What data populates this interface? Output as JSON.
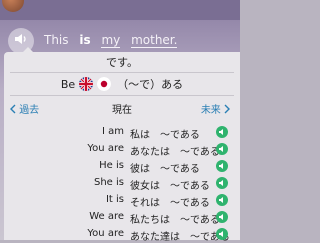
{
  "sentence": {
    "words": [
      "This",
      "is",
      "my",
      "mother."
    ]
  },
  "panel": {
    "word_header": "です。",
    "be_label": "Be",
    "be_meaning": "（〜で）ある",
    "nav": {
      "prev": "過去",
      "current": "現在",
      "next": "未来"
    },
    "rows": [
      {
        "en": "I am",
        "jp": "私は　〜である"
      },
      {
        "en": "You are",
        "jp": "あなたは　〜である"
      },
      {
        "en": "He is",
        "jp": "彼は　〜である"
      },
      {
        "en": "She is",
        "jp": "彼女は　〜である"
      },
      {
        "en": "It is",
        "jp": "それは　〜である"
      },
      {
        "en": "We are",
        "jp": "私たちは　〜である"
      },
      {
        "en": "You are",
        "jp": "あなた達は　〜である"
      }
    ]
  },
  "colors": {
    "accent_blue": "#2a7fb4",
    "play_green": "#2fb36e"
  },
  "icons": [
    "speaker-icon",
    "uk-flag-icon",
    "japan-flag-icon",
    "chevron-left-icon",
    "chevron-right-icon",
    "play-sound-icon"
  ]
}
